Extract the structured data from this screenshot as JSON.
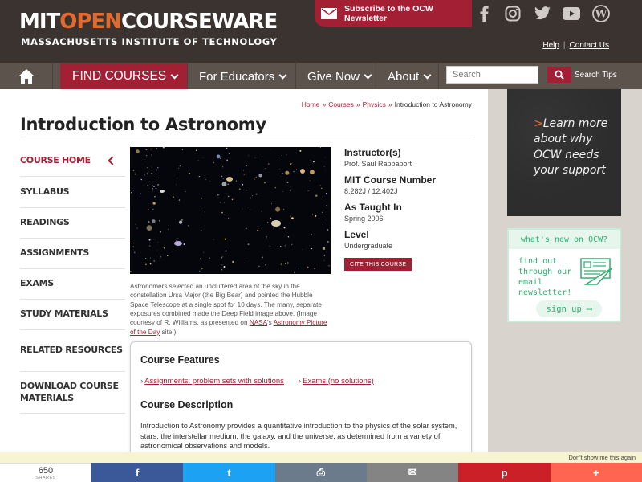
{
  "header": {
    "logo_mit": "MIT",
    "logo_open": "OPEN",
    "logo_courseware": "COURSEWARE",
    "logo_subtitle": "MASSACHUSETTS INSTITUTE OF TECHNOLOGY",
    "subscribe_label": "Subscribe to the OCW Newsletter",
    "social_icons": [
      "facebook-icon",
      "instagram-icon",
      "twitter-icon",
      "youtube-icon",
      "wordpress-icon"
    ],
    "help_link": "Help",
    "contact_link": "Contact Us",
    "separator": "|"
  },
  "nav": {
    "find_courses": "FIND COURSES",
    "for_educators": "For Educators",
    "give_now": "Give Now",
    "about": "About",
    "search_placeholder": "Search",
    "search_tips": "Search Tips"
  },
  "breadcrumb": {
    "items": [
      "Home",
      "Courses",
      "Physics"
    ],
    "separator": "»",
    "current": "Introduction to Astronomy"
  },
  "page_title": "Introduction to Astronomy",
  "sidebar": {
    "items": [
      {
        "label": "COURSE HOME",
        "active": true
      },
      {
        "label": "SYLLABUS"
      },
      {
        "label": "READINGS"
      },
      {
        "label": "ASSIGNMENTS"
      },
      {
        "label": "EXAMS"
      },
      {
        "label": "STUDY MATERIALS"
      },
      {
        "label": "RELATED RESOURCES"
      },
      {
        "label": "DOWNLOAD COURSE MATERIALS"
      }
    ]
  },
  "caption": {
    "text": "Astronomers selected an uncluttered area of the sky in the constellation Ursa Major (the Big Bear) and pointed the Hubble Space Telescope at a single spot for 10 days. The many, separate exposures combined made the Deep Field image above. (Image courtesy of R. Williams, as presented on",
    "link1": "NASA",
    "mid": "'s",
    "link2": "Astronomy Picture of the Day",
    "tail": "site.)"
  },
  "meta": {
    "instructor_label": "Instructor(s)",
    "instructor_value": "Prof. Saul Rappaport",
    "number_label": "MIT Course Number",
    "number_value": "8.282J / 12.402J",
    "taught_label": "As Taught In",
    "taught_value": "Spring 2006",
    "level_label": "Level",
    "level_value": "Undergraduate",
    "cite_button": "CITE THIS COURSE"
  },
  "features": {
    "heading": "Course Features",
    "arrow": "›",
    "links": [
      "Assignments: problem sets with solutions",
      "Exams (no solutions)"
    ],
    "description_heading": "Course Description",
    "description": "Introduction to Astronomy provides a quantitative introduction to the physics of the solar system, stars, the interstellar medium, the galaxy, and the universe, as determined from a variety of astronomical observations and models."
  },
  "promo": {
    "arrow": ">",
    "text": "Learn more about why OCW needs your support"
  },
  "newsletter": {
    "heading": "what's new on OCW?",
    "text": "find out through our email newsletter!",
    "button": "sign up ⟶"
  },
  "sharebar": {
    "dont_show": "Don't show me this again",
    "count": "650",
    "count_label": "SHARES",
    "buttons": [
      {
        "icon": "facebook-icon",
        "glyph": "f",
        "color": "#3b5998"
      },
      {
        "icon": "twitter-icon",
        "glyph": "t",
        "color": "#1da1f2"
      },
      {
        "icon": "print-icon",
        "glyph": "⎙",
        "color": "#6b7b8c"
      },
      {
        "icon": "email-icon",
        "glyph": "✉",
        "color": "#848484"
      },
      {
        "icon": "pinterest-icon",
        "glyph": "p",
        "color": "#cb2027"
      },
      {
        "icon": "more-icon",
        "glyph": "+",
        "color": "#ff6550"
      }
    ]
  },
  "colors": {
    "brand_red": "#a31f34",
    "header_dark": "#3a332f",
    "nav_gray": "#5c534d",
    "newsletter_green": "#2fae72"
  }
}
